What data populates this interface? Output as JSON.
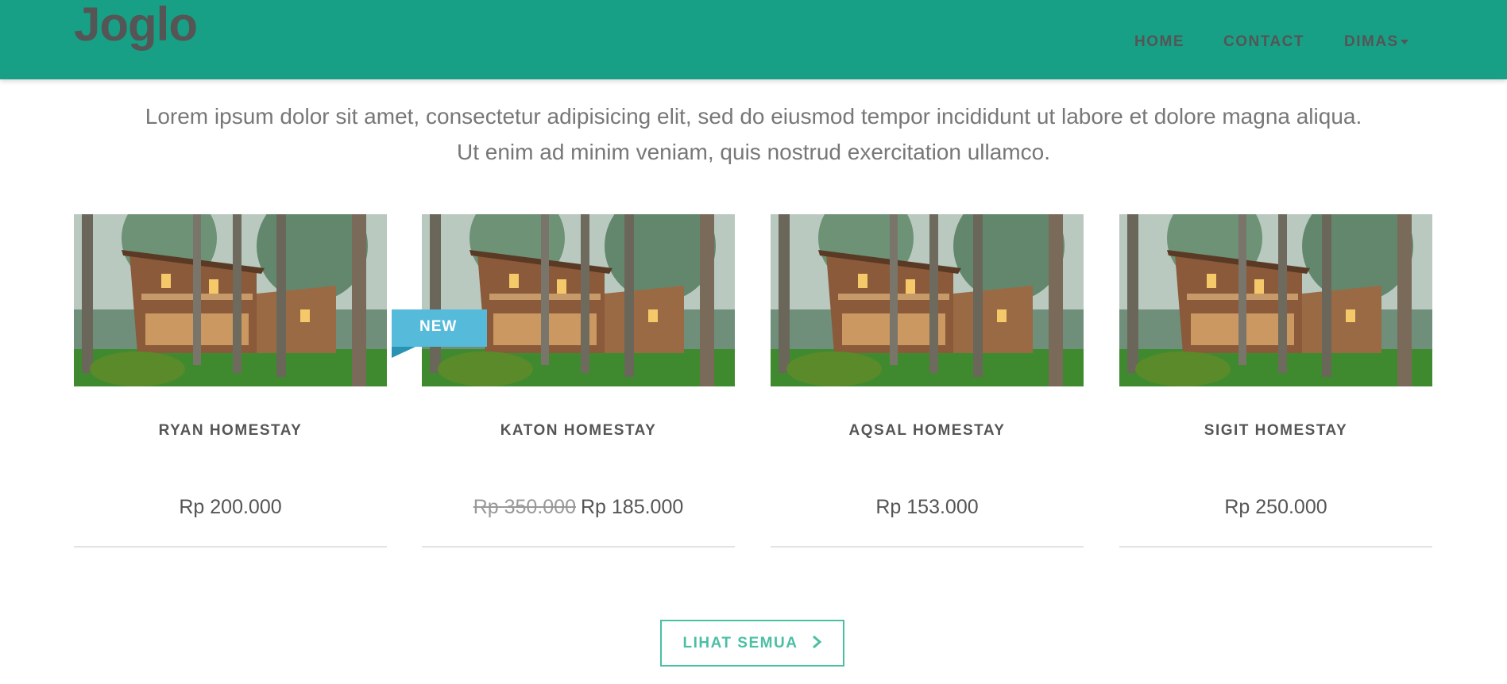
{
  "header": {
    "logo": "Joglo",
    "nav": {
      "home": "HOME",
      "contact": "CONTACT",
      "user": "DIMAS"
    }
  },
  "intro": {
    "line1": "Lorem ipsum dolor sit amet, consectetur adipisicing elit, sed do eiusmod tempor incididunt ut labore et dolore magna aliqua.",
    "line2": "Ut enim ad minim veniam, quis nostrud exercitation ullamco."
  },
  "cards": [
    {
      "title": "RYAN HOMESTAY",
      "price": "Rp 200.000"
    },
    {
      "title": "KATON HOMESTAY",
      "old_price": "Rp 350.000",
      "price": "Rp 185.000",
      "badge": "NEW"
    },
    {
      "title": "AQSAL HOMESTAY",
      "price": "Rp 153.000"
    },
    {
      "title": "SIGIT HOMESTAY",
      "price": "Rp 250.000"
    }
  ],
  "button": {
    "label": "LIHAT SEMUA",
    "icon": "chevron-right-icon"
  },
  "colors": {
    "header": "#17a086",
    "accent": "#4bbfa4",
    "badge": "#56bbdb"
  }
}
